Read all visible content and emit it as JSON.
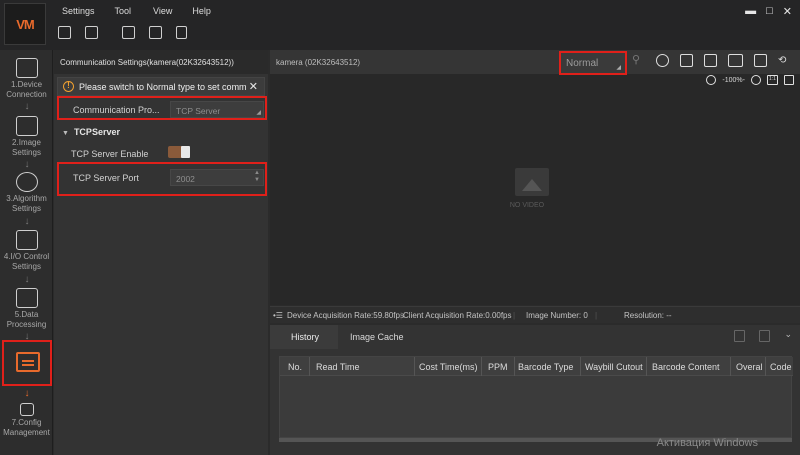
{
  "app": {
    "logo_text": "VM"
  },
  "menu": [
    "Settings",
    "Tool",
    "View",
    "Help"
  ],
  "window_controls": {
    "minimize": "▬",
    "maximize": "□",
    "close": "✕"
  },
  "steps": [
    {
      "label": "1.Device Connection",
      "icon": "camera-link-icon"
    },
    {
      "label": "2.Image Settings",
      "icon": "image-gear-icon"
    },
    {
      "label": "3.Algorithm Settings",
      "icon": "algorithm-icon"
    },
    {
      "label": "4.I/O Control Settings",
      "icon": "io-control-icon"
    },
    {
      "label": "5.Data Processing",
      "icon": "data-processing-icon"
    },
    {
      "label": "",
      "icon": "communication-icon"
    },
    {
      "label": "7.Config Management",
      "icon": "config-icon"
    }
  ],
  "panel": {
    "title": "Communication Settings(kamera(02K32643512))",
    "warning": "Please switch to Normal type to set comm",
    "protocol_label": "Communication Pro...",
    "protocol_value": "TCP Server",
    "section": "TCPServer",
    "enable_label": "TCP Server Enable",
    "enable_on": true,
    "port_label": "TCP Server Port",
    "port_value": "2002"
  },
  "viewer": {
    "title": "kamera (02K32643512)",
    "mode": "Normal",
    "zoom": "-100%-",
    "zoom_fit": "1:1",
    "no_video": "NO VIDEO"
  },
  "status": {
    "device_rate": "Device Acquisition Rate:59.80fps",
    "client_rate": "Client Acquisition Rate:0.00fps",
    "image_number": "Image Number: 0",
    "resolution": "Resolution: --"
  },
  "history": {
    "tabs": [
      "History",
      "Image Cache"
    ],
    "columns": [
      "No.",
      "Read Time",
      "Cost Time(ms)",
      "PPM",
      "Barcode Type",
      "Waybill Cutout",
      "Barcode Content",
      "Overal",
      "Code"
    ]
  },
  "watermark": "Активация Windows",
  "colors": {
    "accent": "#e86a2c",
    "highlight": "#e0201a",
    "background": "#2b2b2b"
  }
}
